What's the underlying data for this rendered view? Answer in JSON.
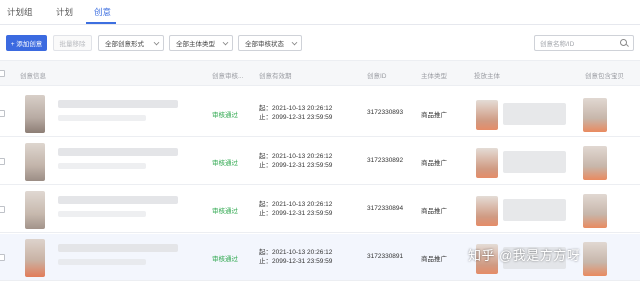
{
  "tabs": [
    {
      "label": "计划组",
      "active": false
    },
    {
      "label": "计划",
      "active": false
    },
    {
      "label": "创意",
      "active": true
    }
  ],
  "toolbar": {
    "add_button": "+ 添加创意",
    "remove_button": "批量移除",
    "filters": [
      {
        "value": "全部创意形式"
      },
      {
        "value": "全部主体类型"
      },
      {
        "value": "全部审核状态"
      }
    ],
    "search_placeholder": "创意名称/ID"
  },
  "table": {
    "columns": [
      "创意信息",
      "创意审核...",
      "创意有效期",
      "创意ID",
      "主体类型",
      "投放主体",
      "创意包含宝贝"
    ],
    "rows": [
      {
        "status": "审核通过",
        "start": "起：2021-10-13 20:26:12",
        "end": "止：2099-12-31 23:59:59",
        "id": "3172330893",
        "subject_type": "商品推广"
      },
      {
        "status": "审核通过",
        "start": "起：2021-10-13 20:26:12",
        "end": "止：2099-12-31 23:59:59",
        "id": "3172330892",
        "subject_type": "商品推广"
      },
      {
        "status": "审核通过",
        "start": "起：2021-10-13 20:26:12",
        "end": "止：2099-12-31 23:59:59",
        "id": "3172330894",
        "subject_type": "商品推广"
      },
      {
        "status": "审核通过",
        "start": "起：2021-10-13 20:26:12",
        "end": "止：2099-12-31 23:59:59",
        "id": "3172330891",
        "subject_type": "商品推广"
      }
    ]
  },
  "watermark": "知乎 @我是方方呀",
  "colors": {
    "accent": "#3b6ae0",
    "status_green": "#2fa84f",
    "selected_row": "#f3f6fd"
  }
}
